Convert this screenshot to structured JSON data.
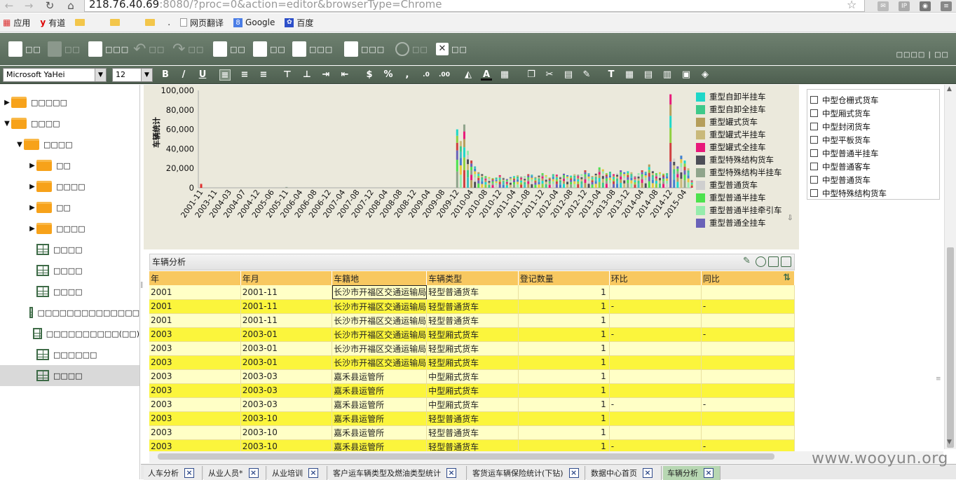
{
  "browser": {
    "url_host": "218.76.40.69",
    "url_rest": ":8080/?proc=0&action=editor&browserType=Chrome",
    "bookmarks": [
      {
        "label": "应用"
      },
      {
        "label": "有道"
      },
      {
        "label": ""
      },
      {
        "label": ""
      },
      {
        "label": ""
      },
      {
        "label": "."
      },
      {
        "label": "网页翻译"
      },
      {
        "label": "Google"
      },
      {
        "label": "百度"
      }
    ]
  },
  "toolbar": {
    "buttons": [
      {
        "label": "□□",
        "icon": "new-file-icon",
        "enabled": true
      },
      {
        "label": "□□",
        "icon": "save-icon",
        "enabled": false
      },
      {
        "label": "□□□",
        "icon": "save-as-icon",
        "enabled": true
      },
      {
        "label": "□□",
        "icon": "undo-icon",
        "enabled": false
      },
      {
        "label": "□□",
        "icon": "redo-icon",
        "enabled": false
      },
      {
        "label": "□□",
        "icon": "data-source-icon",
        "enabled": true
      },
      {
        "label": "□□",
        "icon": "layout-icon",
        "enabled": true
      },
      {
        "label": "□□□",
        "icon": "edit-form-icon",
        "enabled": true
      },
      {
        "label": "□□□",
        "icon": "components-icon",
        "enabled": true
      },
      {
        "label": "□□",
        "icon": "disable-icon",
        "enabled": false
      },
      {
        "label": "□□",
        "icon": "close-icon",
        "enabled": true
      }
    ],
    "right_label": "□□□□ | □□"
  },
  "format_bar": {
    "font": "Microsoft YaHei",
    "size": "12"
  },
  "tree": [
    {
      "label": "□□□□□",
      "type": "folder",
      "level": 0,
      "toggle": "▶"
    },
    {
      "label": "□□□□",
      "type": "folder",
      "level": 0,
      "toggle": "▼"
    },
    {
      "label": "□□□□",
      "type": "folder",
      "level": 1,
      "toggle": "▼"
    },
    {
      "label": "□□",
      "type": "folder",
      "level": 2,
      "toggle": "▶"
    },
    {
      "label": "□□□□",
      "type": "folder",
      "level": 2,
      "toggle": "▶"
    },
    {
      "label": "□□",
      "type": "folder",
      "level": 2,
      "toggle": "▶"
    },
    {
      "label": "□□□□",
      "type": "folder",
      "level": 2,
      "toggle": "▶"
    },
    {
      "label": "□□□□",
      "type": "report",
      "level": 2,
      "toggle": ""
    },
    {
      "label": "□□□□",
      "type": "report",
      "level": 2,
      "toggle": ""
    },
    {
      "label": "□□□□",
      "type": "report",
      "level": 2,
      "toggle": ""
    },
    {
      "label": "□□□□□□□□□□□□□□",
      "type": "report",
      "level": 2,
      "toggle": ""
    },
    {
      "label": "□□□□□□□□□□(□□)",
      "type": "report",
      "level": 2,
      "toggle": ""
    },
    {
      "label": "□□□□□□",
      "type": "report",
      "level": 2,
      "toggle": ""
    },
    {
      "label": "□□□□",
      "type": "report",
      "level": 2,
      "toggle": "",
      "selected": true
    }
  ],
  "chart_data": {
    "type": "bar",
    "ylabel": "车辆统计",
    "y_ticks": [
      "0",
      "20,000",
      "40,000",
      "60,000",
      "80,000",
      "100,000"
    ],
    "ylim": [
      0,
      100000
    ],
    "x_tick_labels": [
      "2001-11",
      "2003-11",
      "2004-03",
      "2004-07",
      "2004-12",
      "2005-06",
      "2005-11",
      "2006-04",
      "2006-08",
      "2006-12",
      "2007-04",
      "2007-08",
      "2007-12",
      "2008-04",
      "2008-08",
      "2008-12",
      "2009-04",
      "2009-08",
      "2009-12",
      "2010-04",
      "2010-08",
      "2010-12",
      "2011-04",
      "2011-08",
      "2011-12",
      "2012-04",
      "2012-08",
      "2012-12",
      "2013-04",
      "2013-08",
      "2013-12",
      "2014-04",
      "2014-08",
      "2014-12",
      "2015-04"
    ],
    "series_stacked": true,
    "bars": [
      {
        "x": "2001-11",
        "total": 4000
      },
      {
        "x": "2005-11",
        "total": 800
      },
      {
        "x": "2009-12",
        "total": 60000
      },
      {
        "x": "2010-01",
        "total": 48000
      },
      {
        "x": "2010-02",
        "total": 65000
      },
      {
        "x": "2010-03",
        "total": 38000
      },
      {
        "x": "2010-04",
        "total": 28000
      },
      {
        "x": "2010-05",
        "total": 22000
      },
      {
        "x": "2010-06",
        "total": 16000
      },
      {
        "x": "2010-07",
        "total": 14000
      },
      {
        "x": "2010-08",
        "total": 12000
      },
      {
        "x": "2010-09",
        "total": 11000
      },
      {
        "x": "2010-10",
        "total": 10000
      },
      {
        "x": "2010-11",
        "total": 10500
      },
      {
        "x": "2010-12",
        "total": 13000
      },
      {
        "x": "2011-01",
        "total": 11000
      },
      {
        "x": "2011-02",
        "total": 9000
      },
      {
        "x": "2011-03",
        "total": 11000
      },
      {
        "x": "2011-04",
        "total": 12000
      },
      {
        "x": "2011-05",
        "total": 13000
      },
      {
        "x": "2011-06",
        "total": 11500
      },
      {
        "x": "2011-07",
        "total": 12000
      },
      {
        "x": "2011-08",
        "total": 14000
      },
      {
        "x": "2011-09",
        "total": 13500
      },
      {
        "x": "2011-10",
        "total": 11000
      },
      {
        "x": "2011-11",
        "total": 12500
      },
      {
        "x": "2011-12",
        "total": 15000
      },
      {
        "x": "2012-01",
        "total": 13000
      },
      {
        "x": "2012-02",
        "total": 10500
      },
      {
        "x": "2012-03",
        "total": 14000
      },
      {
        "x": "2012-04",
        "total": 13500
      },
      {
        "x": "2012-05",
        "total": 12000
      },
      {
        "x": "2012-06",
        "total": 14500
      },
      {
        "x": "2012-07",
        "total": 13000
      },
      {
        "x": "2012-08",
        "total": 12500
      },
      {
        "x": "2012-09",
        "total": 14000
      },
      {
        "x": "2012-10",
        "total": 13500
      },
      {
        "x": "2012-11",
        "total": 14000
      },
      {
        "x": "2012-12",
        "total": 18000
      },
      {
        "x": "2013-01",
        "total": 15000
      },
      {
        "x": "2013-02",
        "total": 12000
      },
      {
        "x": "2013-03",
        "total": 14500
      },
      {
        "x": "2013-04",
        "total": 21000
      },
      {
        "x": "2013-05",
        "total": 19000
      },
      {
        "x": "2013-06",
        "total": 15000
      },
      {
        "x": "2013-07",
        "total": 16500
      },
      {
        "x": "2013-08",
        "total": 14000
      },
      {
        "x": "2013-09",
        "total": 15000
      },
      {
        "x": "2013-10",
        "total": 18000
      },
      {
        "x": "2013-11",
        "total": 16000
      },
      {
        "x": "2013-12",
        "total": 17000
      },
      {
        "x": "2014-01",
        "total": 16000
      },
      {
        "x": "2014-02",
        "total": 12000
      },
      {
        "x": "2014-03",
        "total": 15000
      },
      {
        "x": "2014-04",
        "total": 18000
      },
      {
        "x": "2014-05",
        "total": 16500
      },
      {
        "x": "2014-06",
        "total": 24000
      },
      {
        "x": "2014-07",
        "total": 17000
      },
      {
        "x": "2014-08",
        "total": 15000
      },
      {
        "x": "2014-09",
        "total": 16000
      },
      {
        "x": "2014-10",
        "total": 14500
      },
      {
        "x": "2014-11",
        "total": 15000
      },
      {
        "x": "2014-12",
        "total": 96000
      },
      {
        "x": "2015-01",
        "total": 30000
      },
      {
        "x": "2015-02",
        "total": 22000
      },
      {
        "x": "2015-03",
        "total": 33000
      },
      {
        "x": "2015-04",
        "total": 28000
      },
      {
        "x": "2015-05",
        "total": 20000
      },
      {
        "x": "2015-06",
        "total": 8000
      }
    ],
    "legend": [
      {
        "name": "重型自卸半挂车",
        "color": "#1fd7c8"
      },
      {
        "name": "重型自卸全挂车",
        "color": "#3ec98a"
      },
      {
        "name": "重型罐式货车",
        "color": "#b59e5b"
      },
      {
        "name": "重型罐式半挂车",
        "color": "#c9b97a"
      },
      {
        "name": "重型罐式全挂车",
        "color": "#e8197a"
      },
      {
        "name": "重型特殊结构货车",
        "color": "#4d4e57"
      },
      {
        "name": "重型特殊结构半挂车",
        "color": "#8fa48b"
      },
      {
        "name": "重型普通货车",
        "color": "#cfcfcf"
      },
      {
        "name": "重型普通半挂车",
        "color": "#4de24d"
      },
      {
        "name": "重型普通半挂牵引车",
        "color": "#96ecac"
      },
      {
        "name": "重型普通全挂车",
        "color": "#6a62b8"
      }
    ]
  },
  "filter_list": [
    "中型仓栅式货车",
    "中型厢式货车",
    "中型封闭货车",
    "中型平板货车",
    "中型普通半挂车",
    "中型普通客车",
    "中型普通货车",
    "中型特殊结构货车"
  ],
  "table": {
    "title": "车辆分析",
    "headers": [
      "年",
      "年月",
      "车籍地",
      "车辆类型",
      "登记数量",
      "环比",
      "同比"
    ],
    "rows": [
      [
        "2001",
        "2001-11",
        "长沙市开福区交通运输局",
        "轻型普通货车",
        "1",
        "",
        ""
      ],
      [
        "2001",
        "2001-11",
        "长沙市开福区交通运输局",
        "轻型普通货车",
        "1",
        "-",
        "-"
      ],
      [
        "2001",
        "2001-11",
        "长沙市开福区交通运输局",
        "轻型普通货车",
        "1",
        "",
        ""
      ],
      [
        "2003",
        "2003-01",
        "长沙市开福区交通运输局",
        "轻型厢式货车",
        "1",
        "-",
        "-"
      ],
      [
        "2003",
        "2003-01",
        "长沙市开福区交通运输局",
        "轻型厢式货车",
        "1",
        "",
        ""
      ],
      [
        "2003",
        "2003-01",
        "长沙市开福区交通运输局",
        "轻型厢式货车",
        "1",
        "",
        ""
      ],
      [
        "2003",
        "2003-03",
        "嘉禾县运管所",
        "中型厢式货车",
        "1",
        "",
        ""
      ],
      [
        "2003",
        "2003-03",
        "嘉禾县运管所",
        "中型厢式货车",
        "1",
        "",
        ""
      ],
      [
        "2003",
        "2003-03",
        "嘉禾县运管所",
        "中型厢式货车",
        "1",
        "-",
        "-"
      ],
      [
        "2003",
        "2003-10",
        "嘉禾县运管所",
        "轻型普通货车",
        "1",
        "",
        ""
      ],
      [
        "2003",
        "2003-10",
        "嘉禾县运管所",
        "轻型普通货车",
        "1",
        "",
        ""
      ],
      [
        "2003",
        "2003-10",
        "嘉禾县运管所",
        "轻型普通货车",
        "1",
        "-",
        "-"
      ]
    ]
  },
  "bottom_tabs": [
    {
      "label": "人车分析",
      "active": false
    },
    {
      "label": "从业人员*",
      "active": false
    },
    {
      "label": "从业培训",
      "active": false
    },
    {
      "label": "客户运车辆类型及燃油类型统计",
      "active": false
    },
    {
      "label": "客货运车辆保险统计(下钻)",
      "active": false
    },
    {
      "label": "数据中心首页",
      "active": false
    },
    {
      "label": "车辆分析",
      "active": true
    }
  ],
  "watermark": "www.wooyun.org"
}
